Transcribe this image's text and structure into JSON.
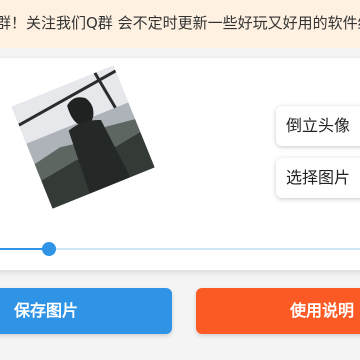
{
  "notice": {
    "text": "群！关注我们Q群 会不定时更新一些好玩又好用的软件给大家"
  },
  "editor": {
    "rotate_button_label": "倒立头像",
    "choose_button_label": "选择图片",
    "slider_value_fraction": 0.135
  },
  "actions": {
    "save_label": "保存图片",
    "help_label": "使用说明"
  },
  "colors": {
    "notice_bg": "#fef1e1",
    "slider_active": "#2f93e6",
    "slider_inactive": "#cfe6f7",
    "save_button": "#2f93e6",
    "help_button": "#fb5a24"
  }
}
